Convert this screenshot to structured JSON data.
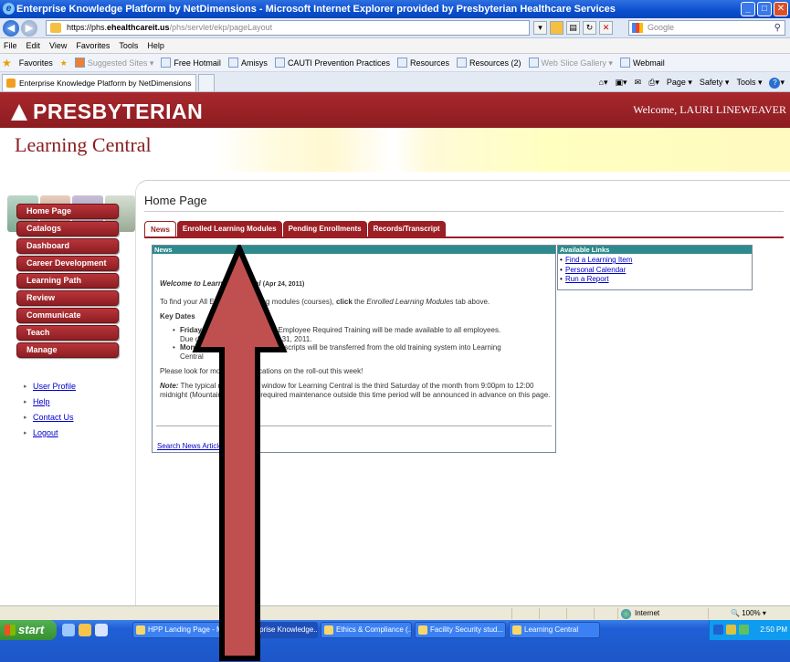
{
  "window": {
    "title": "Enterprise Knowledge Platform by NetDimensions - Microsoft Internet Explorer provided by Presbyterian Healthcare Services",
    "buttons": [
      "_",
      "□",
      "✕"
    ]
  },
  "address": {
    "proto": "https://phs.",
    "domain": "ehealthcareit.us",
    "path": "/phs/servlet/ekp/pageLayout",
    "search_placeholder": "Google"
  },
  "menu": [
    "File",
    "Edit",
    "View",
    "Favorites",
    "Tools",
    "Help"
  ],
  "favorites": {
    "label": "Favorites",
    "items": [
      {
        "label": "Suggested Sites ▾",
        "dim": true
      },
      {
        "label": "Free Hotmail",
        "dim": false
      },
      {
        "label": "Amisys",
        "dim": false
      },
      {
        "label": "CAUTI Prevention Practices",
        "dim": false
      },
      {
        "label": "Resources",
        "dim": false
      },
      {
        "label": "Resources (2)",
        "dim": false
      },
      {
        "label": "Web Slice Gallery ▾",
        "dim": true
      },
      {
        "label": "Webmail",
        "dim": false
      }
    ]
  },
  "browser_tab": {
    "label": "Enterprise Knowledge Platform by NetDimensions"
  },
  "command_bar": [
    "▾",
    "▾",
    "▾",
    "Page ▾",
    "Safety ▾",
    "Tools ▾",
    "▾"
  ],
  "header": {
    "logo": "PRESBYTERIAN",
    "welcome": "Welcome, LAURI LINEWEAVER",
    "section_title": "Learning Central"
  },
  "nav": {
    "items": [
      "Home Page",
      "Catalogs",
      "Dashboard",
      "Career Development",
      "Learning Path",
      "Review",
      "Communicate",
      "Teach",
      "Manage"
    ],
    "links": [
      "User Profile",
      "Help",
      "Contact Us",
      "Logout"
    ]
  },
  "page": {
    "title": "Home Page",
    "tabs": [
      "News",
      "Enrolled Learning Modules",
      "Pending Enrollments",
      "Records/Transcript"
    ],
    "active_tab": "News"
  },
  "news": {
    "header": "News",
    "welcome": "Welcome to Learning Central",
    "welcome_date": "(Apr 24, 2011)",
    "para1_a": "To find your All Employee Training modules (courses), ",
    "para1_click": "click",
    "para1_b": " the ",
    "para1_tab": "Enrolled Learning Modules",
    "para1_c": " tab above.",
    "key_dates": "Key Dates",
    "item1_key": "Friday",
    "item1_text": " April 29th, the 2011 All Employee Required Training will be made available to all employees.",
    "item1_sub": "Due date for completion is July 31, 2011.",
    "item2_key": "Month of May",
    "item2_text": " - Employees transcripts will be transferred from the old training system into Learning",
    "item2_sub": "Central",
    "para2": "Please look for more communications on the roll-out this week!",
    "para3_note": "Note:",
    "para3": " The typical maintenance window for Learning Central is the third Saturday of the month from 9:00pm to 12:00 midnight (Mountain Time).  Any required maintenance outside this time period will be announced in advance on this page.",
    "search": "Search News Articles"
  },
  "links_box": {
    "header": "Available Links",
    "links": [
      "Find a Learning Item",
      "Personal Calendar",
      "Run a Report"
    ]
  },
  "status": {
    "zone": "Internet",
    "zoom": "100%"
  },
  "taskbar": {
    "start": "start",
    "tasks": [
      "HPP Landing Page - M...",
      "Enterprise Knowledge...",
      "Ethics & Compliance (...",
      "Facility Security stud...",
      "Learning Central"
    ],
    "clock": "2:50 PM"
  },
  "colors": {
    "brand_red": "#9b1f24",
    "teal_header": "#2e8a8c",
    "arrow_fill": "#c05050"
  }
}
